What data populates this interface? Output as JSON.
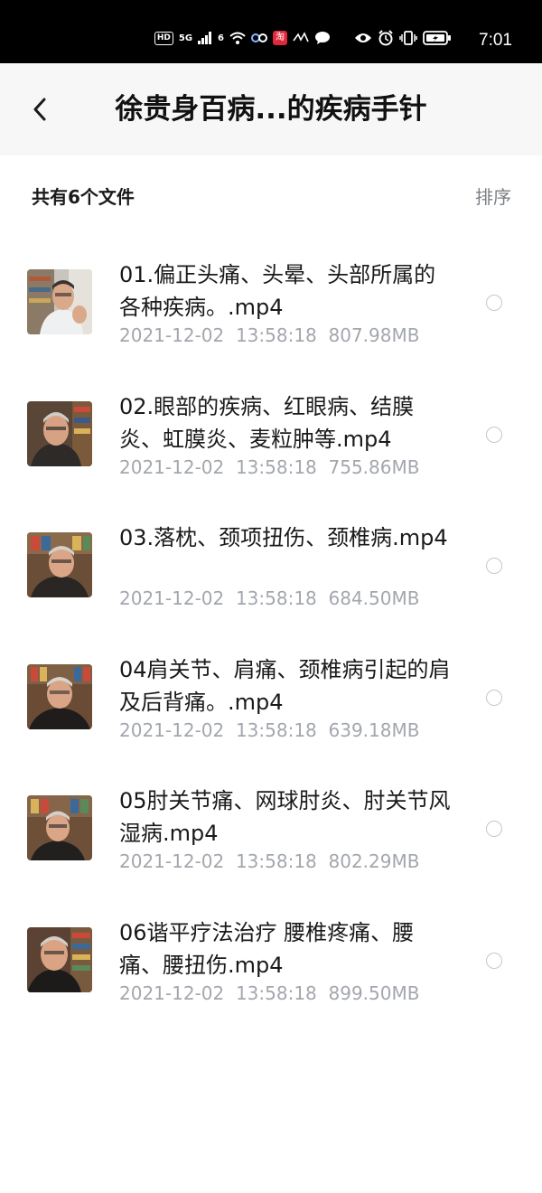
{
  "status_bar": {
    "hd": "HD",
    "net1": "5G",
    "net2": "6",
    "app_badge": "淘",
    "time": "7:01"
  },
  "header": {
    "title": "徐贵身百病...的疾病手针"
  },
  "summary": {
    "count_label": "共有6个文件",
    "sort_label": "排序"
  },
  "files": [
    {
      "name": "01.偏正头痛、头晕、头部所属的各种疾病。.mp4",
      "date": "2021-12-02",
      "time": "13:58:18",
      "size": "807.98MB"
    },
    {
      "name": "02.眼部的疾病、红眼病、结膜炎、虹膜炎、麦粒肿等.mp4",
      "date": "2021-12-02",
      "time": "13:58:18",
      "size": "755.86MB"
    },
    {
      "name": "03.落枕、颈项扭伤、颈椎病.mp4",
      "date": "2021-12-02",
      "time": "13:58:18",
      "size": "684.50MB"
    },
    {
      "name": "04肩关节、肩痛、颈椎病引起的肩及后背痛。.mp4",
      "date": "2021-12-02",
      "time": "13:58:18",
      "size": "639.18MB"
    },
    {
      "name": "05肘关节痛、网球肘炎、肘关节风湿病.mp4",
      "date": "2021-12-02",
      "time": "13:58:18",
      "size": "802.29MB"
    },
    {
      "name": "06谐平疗法治疗 腰椎疼痛、腰痛、腰扭伤.mp4",
      "date": "2021-12-02",
      "time": "13:58:18",
      "size": "899.50MB"
    }
  ],
  "icons": {
    "back": "chevron-left-icon",
    "radio": "radio-unchecked-icon",
    "thumbnail": "video-thumbnail"
  }
}
